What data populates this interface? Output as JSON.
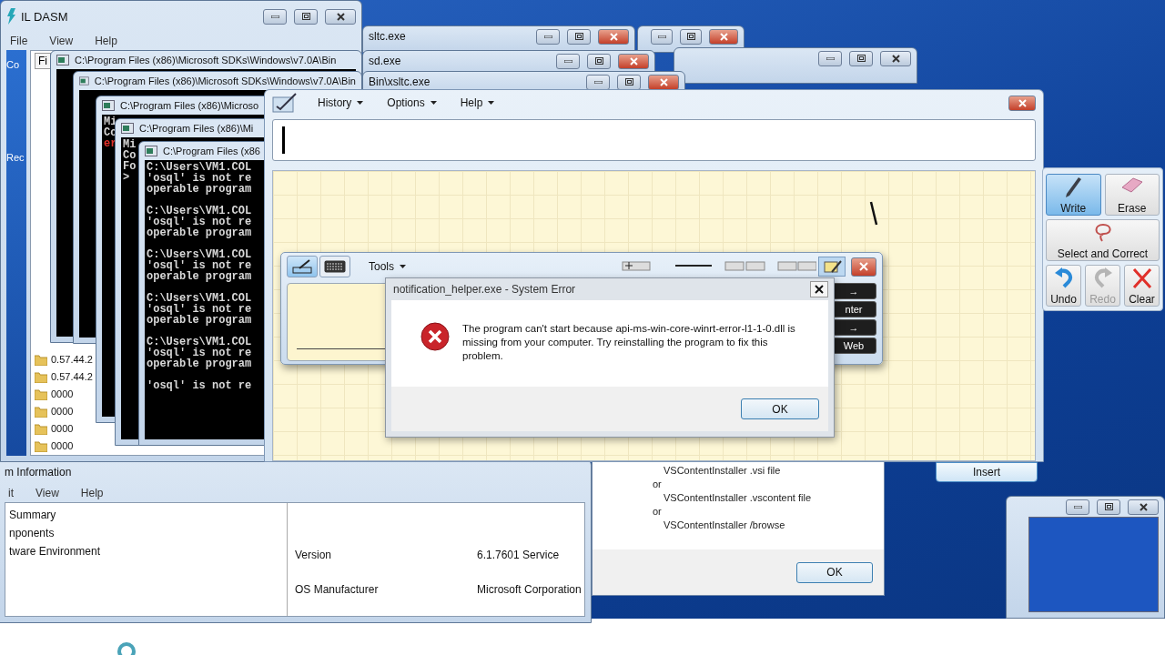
{
  "desktop": {
    "labels": [
      "Co",
      "Rec"
    ]
  },
  "background_windows": [
    {
      "active": true
    },
    {
      "active": false
    },
    {
      "title": "sltc.exe",
      "active": true
    },
    {
      "title": "sd.exe",
      "active": true
    },
    {
      "title": "Bin\\xsltc.exe",
      "active": true
    },
    {
      "active": false
    }
  ],
  "system_information": {
    "title": "m Information",
    "menu": [
      "it",
      "View",
      "Help"
    ],
    "tree": [
      "Summary",
      "nponents",
      "tware Environment"
    ],
    "rows": [
      {
        "item": "Version",
        "value": "6.1.7601 Service"
      },
      {
        "item": "OS Manufacturer",
        "value": "Microsoft Corporation"
      }
    ]
  },
  "installer_message": {
    "lines": [
      {
        "text": "VSContentInstaller .vsi file",
        "kind": "command"
      },
      {
        "text": "or",
        "kind": "joiner"
      },
      {
        "text": "VSContentInstaller .vscontent file",
        "kind": "command"
      },
      {
        "text": "or",
        "kind": "joiner"
      },
      {
        "text": "VSContentInstaller /browse",
        "kind": "command"
      }
    ],
    "button": "OK"
  },
  "il_dasm": {
    "title": "IL DASM",
    "menu": [
      "File",
      "View",
      "Help"
    ],
    "tab": "Fi",
    "tree": [
      "0.57.44.2",
      "0.57.44.2",
      "0000",
      "0000",
      "0000",
      "0000"
    ]
  },
  "consoles": [
    {
      "title": "C:\\Program Files (x86)\\Microsoft SDKs\\Windows\\v7.0A\\Bin"
    },
    {
      "title": "C:\\Program Files (x86)\\Microsoft SDKs\\Windows\\v7.0A\\Bin"
    },
    {
      "title": "C:\\Program Files (x86)\\Microso",
      "lines": [
        {
          "text": "Mi",
          "error": false
        },
        {
          "text": "Co",
          "error": false
        },
        {
          "text": "er",
          "error": true
        }
      ]
    },
    {
      "title": "C:\\Program Files (x86)\\Mi",
      "lines": [
        {
          "text": "Mi",
          "error": false
        },
        {
          "text": "Co",
          "error": false
        },
        {
          "text": "Fo",
          "error": false
        },
        {
          "text": ">",
          "error": false
        }
      ]
    },
    {
      "title": "C:\\Program Files (x86",
      "lines": [
        {
          "text": "C:\\Users\\VM1.COL",
          "error": false
        },
        {
          "text": "'osql' is not re",
          "error": false
        },
        {
          "text": "operable program",
          "error": false
        },
        {
          "text": "C:\\Users\\VM1.COL",
          "error": false
        },
        {
          "text": "'osql' is not re",
          "error": false
        },
        {
          "text": "operable program",
          "error": false
        },
        {
          "text": "C:\\Users\\VM1.COL",
          "error": false
        },
        {
          "text": "'osql' is not re",
          "error": false
        },
        {
          "text": "operable program",
          "error": false
        },
        {
          "text": "C:\\Users\\VM1.COL",
          "error": false
        },
        {
          "text": "'osql' is not re",
          "error": false
        },
        {
          "text": "operable program",
          "error": false
        },
        {
          "text": "C:\\Users\\VM1.COL",
          "error": false
        },
        {
          "text": "'osql' is not re",
          "error": false
        },
        {
          "text": "operable program",
          "error": false
        },
        {
          "text": "'osql' is not re",
          "error": false
        }
      ]
    }
  ],
  "math_input": {
    "menus": [
      "History",
      "Options",
      "Help"
    ],
    "insert": "Insert",
    "tools": [
      {
        "label": "Write",
        "kind": "write",
        "selected": true,
        "disabled": false
      },
      {
        "label": "Erase",
        "kind": "erase",
        "selected": false,
        "disabled": false
      },
      {
        "label": "Select and Correct",
        "kind": "select",
        "selected": false,
        "disabled": false
      },
      {
        "label": "Undo",
        "kind": "undo",
        "selected": false,
        "disabled": false
      },
      {
        "label": "Redo",
        "kind": "redo",
        "selected": false,
        "disabled": true
      },
      {
        "label": "Clear",
        "kind": "clear",
        "selected": false,
        "disabled": false
      }
    ]
  },
  "tablet_panel": {
    "modes": [
      {
        "kind": "pen",
        "selected": true
      },
      {
        "kind": "keyboard",
        "selected": false
      }
    ],
    "menu": "Tools",
    "keys": [
      "→",
      "nter",
      "→",
      "Web"
    ]
  },
  "error_dialog": {
    "title": "notification_helper.exe - System Error",
    "message": "The program can't start because api-ms-win-core-winrt-error-l1-1-0.dll is missing from your computer. Try reinstalling the program to fix this problem.",
    "button": "OK"
  }
}
